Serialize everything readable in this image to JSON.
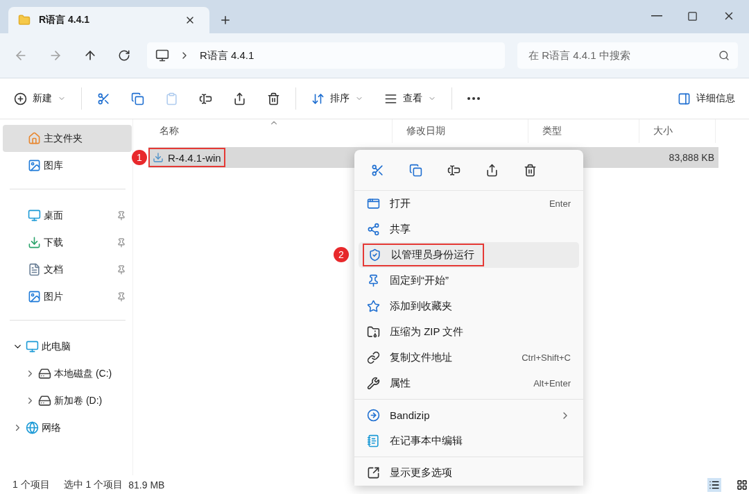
{
  "tabs": [
    {
      "title": "R语言 4.4.1",
      "selected": true
    }
  ],
  "address": {
    "path": [
      "R语言 4.4.1"
    ],
    "search_placeholder": "在 R语言 4.4.1 中搜索"
  },
  "toolbar": {
    "items": [
      {
        "kind": "new",
        "label": "新建",
        "disabled": false
      },
      {
        "kind": "cut",
        "disabled": false
      },
      {
        "kind": "copy",
        "disabled": false
      },
      {
        "kind": "paste",
        "disabled": true
      },
      {
        "kind": "rename",
        "disabled": false
      },
      {
        "kind": "share",
        "disabled": false
      },
      {
        "kind": "delete",
        "disabled": false
      },
      {
        "kind": "sort",
        "label": "排序",
        "disabled": false
      },
      {
        "kind": "view",
        "label": "查看",
        "disabled": false
      },
      {
        "kind": "more",
        "disabled": false
      }
    ],
    "details_label": "详细信息"
  },
  "sidebar": {
    "groups": [
      [
        {
          "kind": "home",
          "label": "主文件夹",
          "selected": true,
          "pinned": false
        },
        {
          "kind": "gallery",
          "label": "图库",
          "selected": false,
          "pinned": false
        }
      ],
      [
        {
          "kind": "desktop",
          "label": "桌面",
          "selected": false,
          "pinned": true
        },
        {
          "kind": "download",
          "label": "下载",
          "selected": false,
          "pinned": true
        },
        {
          "kind": "document",
          "label": "文档",
          "selected": false,
          "pinned": true
        },
        {
          "kind": "picture",
          "label": "图片",
          "selected": false,
          "pinned": true
        }
      ],
      [
        {
          "kind": "pc",
          "label": "此电脑",
          "selected": false,
          "pinned": false,
          "expanded": true,
          "children": [
            {
              "kind": "drive",
              "label": "本地磁盘 (C:)",
              "selected": false,
              "pinned": false,
              "expanded": false
            },
            {
              "kind": "drive",
              "label": "新加卷 (D:)",
              "selected": false,
              "pinned": false,
              "expanded": false
            }
          ]
        },
        {
          "kind": "network",
          "label": "网络",
          "selected": false,
          "pinned": false,
          "expanded": false
        }
      ]
    ]
  },
  "table": {
    "columns": [
      {
        "label": "名称",
        "sorted": true
      },
      {
        "label": "修改日期",
        "sorted": false
      },
      {
        "label": "类型",
        "sorted": false
      },
      {
        "label": "大小",
        "sorted": false
      }
    ],
    "rows": [
      {
        "name": "R-4.4.1-win",
        "size": "83,888 KB",
        "selected": true,
        "callout": "1"
      }
    ]
  },
  "context_menu": {
    "quick_actions": [
      {
        "kind": "cut"
      },
      {
        "kind": "copy"
      },
      {
        "kind": "rename"
      },
      {
        "kind": "share"
      },
      {
        "kind": "delete"
      }
    ],
    "items": [
      {
        "kind": "open",
        "label": "打开",
        "shortcut": "Enter",
        "selected": false
      },
      {
        "kind": "share",
        "label": "共享",
        "selected": false
      },
      {
        "kind": "admin",
        "label": "以管理员身份运行",
        "selected": true,
        "callout": "2"
      },
      {
        "kind": "pin",
        "label": "固定到“开始”",
        "selected": false
      },
      {
        "kind": "favorite",
        "label": "添加到收藏夹",
        "selected": false
      },
      {
        "kind": "zip",
        "label": "压缩为 ZIP 文件",
        "selected": false
      },
      {
        "kind": "path",
        "label": "复制文件地址",
        "shortcut": "Ctrl+Shift+C",
        "selected": false
      },
      {
        "kind": "properties",
        "label": "属性",
        "shortcut": "Alt+Enter",
        "selected": false
      },
      {
        "kind": "separator"
      },
      {
        "kind": "bandizip",
        "label": "Bandizip",
        "submenu": true,
        "selected": false
      },
      {
        "kind": "notepad",
        "label": "在记事本中编辑",
        "selected": false
      },
      {
        "kind": "separator"
      },
      {
        "kind": "more",
        "label": "显示更多选项",
        "selected": false
      }
    ]
  },
  "status_bar": {
    "count": "1 个项目",
    "selection": "选中 1 个项目",
    "size": "81.9 MB",
    "views": [
      {
        "kind": "details",
        "selected": true
      },
      {
        "kind": "tiles",
        "selected": false
      }
    ]
  }
}
